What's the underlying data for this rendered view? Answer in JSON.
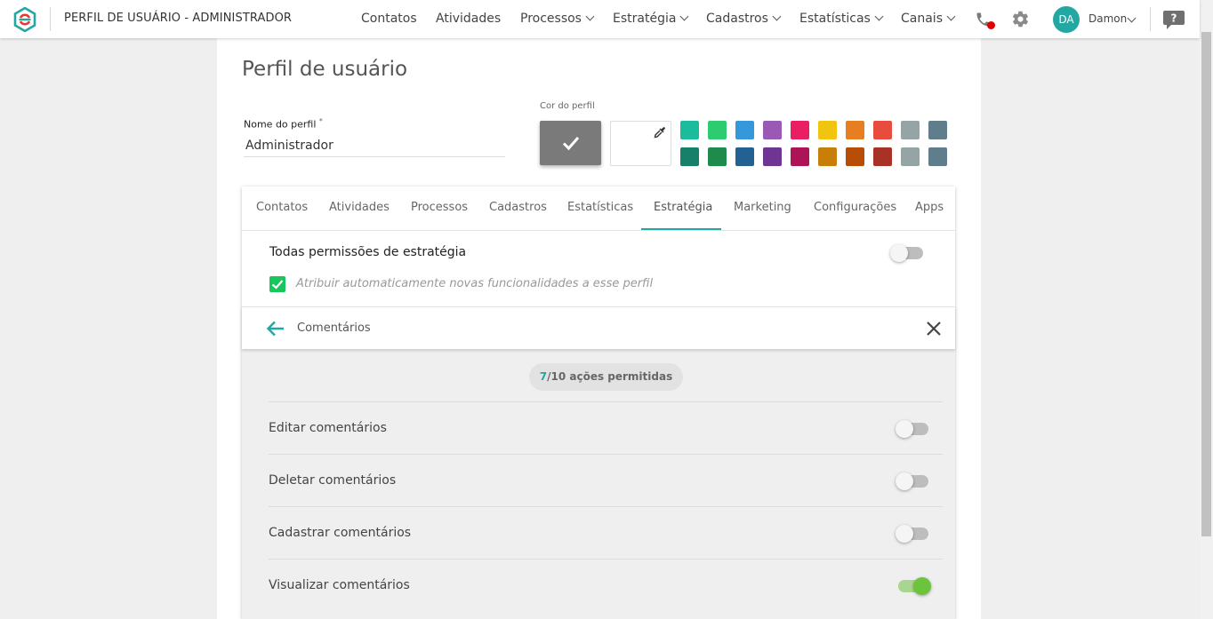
{
  "header": {
    "title": "PERFIL DE USUÁRIO - ADMINISTRADOR",
    "nav": [
      {
        "label": "Contatos",
        "dropdown": false
      },
      {
        "label": "Atividades",
        "dropdown": false
      },
      {
        "label": "Processos",
        "dropdown": true
      },
      {
        "label": "Estratégia",
        "dropdown": true
      },
      {
        "label": "Cadastros",
        "dropdown": true
      },
      {
        "label": "Estatísticas",
        "dropdown": true
      },
      {
        "label": "Canais",
        "dropdown": true
      }
    ],
    "icons": {
      "phone": "phone-icon",
      "settings": "gear-icon",
      "help": "help-icon"
    },
    "user": {
      "initials": "DA",
      "name": "Damon"
    }
  },
  "page": {
    "title": "Perfil de usuário",
    "profile_name_label": "Nome do perfil",
    "required_mark": "*",
    "profile_name_value": "Administrador",
    "color_label": "Cor do perfil",
    "selected_color": "#7a7a7a",
    "swatches": [
      [
        "#1abc9c",
        "#2ecc71",
        "#3498db",
        "#9b59b6",
        "#e91e63",
        "#f1c40f",
        "#e67e22",
        "#e74c3c",
        "#95a5a6",
        "#607d8b"
      ],
      [
        "#16806a",
        "#1e8a4c",
        "#236193",
        "#6f3595",
        "#ad1457",
        "#c87f0a",
        "#b84e05",
        "#a93226",
        "#95a5a6",
        "#607d8b"
      ]
    ]
  },
  "tabs": [
    "Contatos",
    "Atividades",
    "Processos",
    "Cadastros",
    "Estatísticas",
    "Estratégia",
    "Marketing",
    "Configurações",
    "Apps"
  ],
  "active_tab": "Estratégia",
  "strategy": {
    "all_permissions_label": "Todas permissões de estratégia",
    "all_permissions_on": false,
    "auto_assign_label": "Atribuir automaticamente novas funcionalidades a esse perfil",
    "auto_assign_checked": true
  },
  "section": {
    "title": "Comentários",
    "allowed": "7",
    "total_text": "/10 ações permitidas",
    "permissions": [
      {
        "label": "Editar comentários",
        "on": false
      },
      {
        "label": "Deletar comentários",
        "on": false
      },
      {
        "label": "Cadastrar comentários",
        "on": false
      },
      {
        "label": "Visualizar comentários",
        "on": true
      }
    ]
  },
  "colors": {
    "accent": "#23a7a3",
    "checkbox": "#17c65c",
    "toggle_on": "#6cc43d",
    "notification": "#e00000"
  }
}
